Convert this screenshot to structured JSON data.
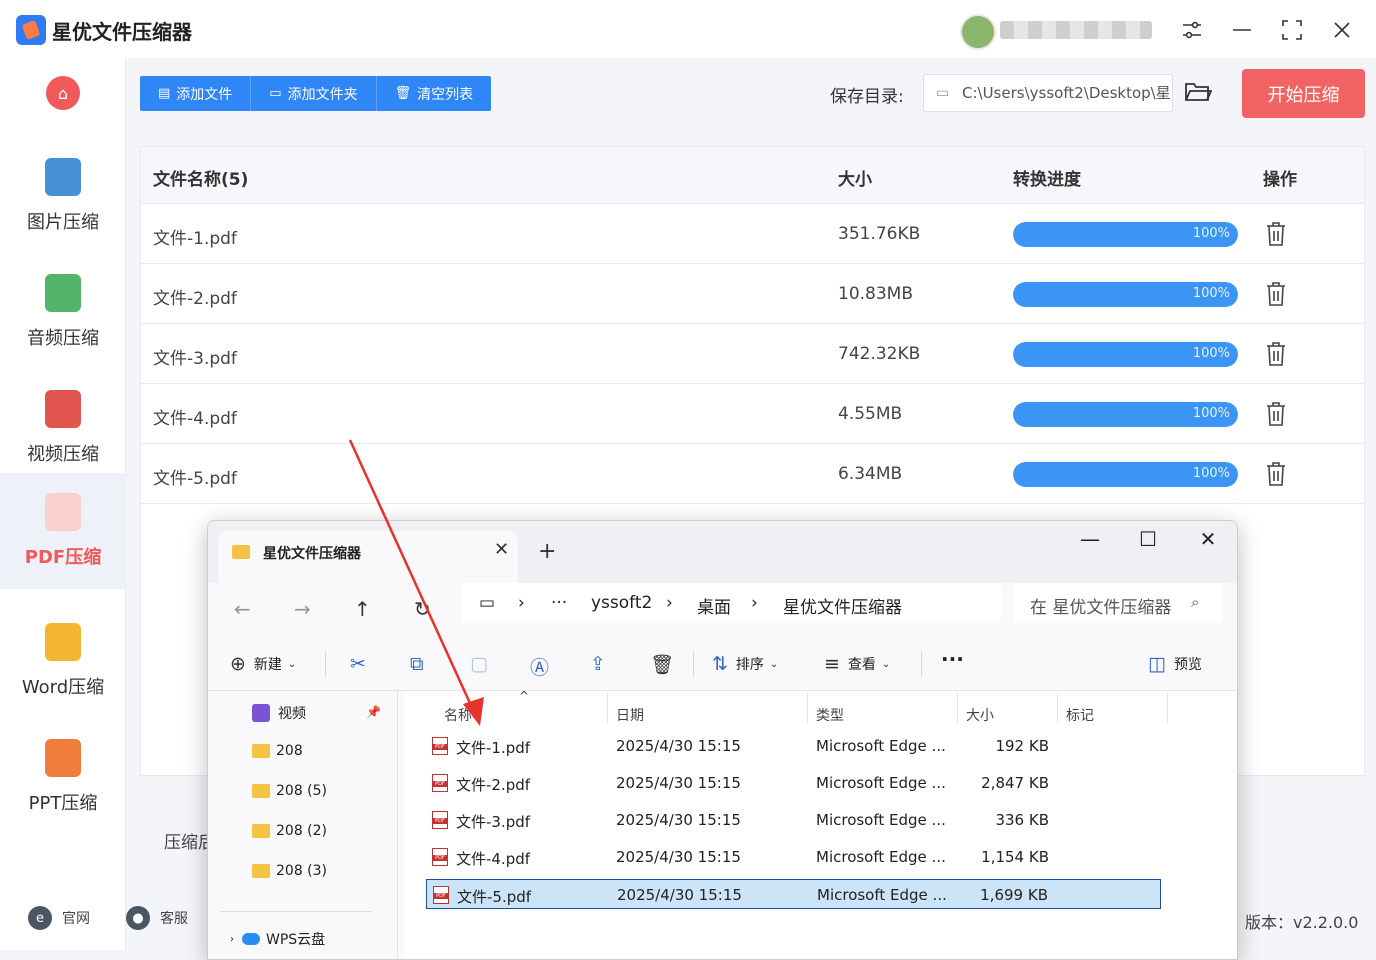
{
  "app": {
    "title": "星优文件压缩器",
    "version": "版本：v2.2.0.0"
  },
  "sidebar": {
    "items": [
      {
        "label": "图片压缩",
        "icon": "image-icon",
        "color": "#4a90d9"
      },
      {
        "label": "音频压缩",
        "icon": "audio-icon",
        "color": "#56b36a"
      },
      {
        "label": "视频压缩",
        "icon": "video-icon",
        "color": "#e0564e"
      },
      {
        "label": "PDF压缩",
        "icon": "pdf-icon",
        "color": "#f15a5a"
      },
      {
        "label": "Word压缩",
        "icon": "word-icon",
        "color": "#f2b632"
      },
      {
        "label": "PPT压缩",
        "icon": "ppt-icon",
        "color": "#ef7d3b"
      }
    ],
    "footer": {
      "website": "官网",
      "support": "客服"
    }
  },
  "toolbar": {
    "add_file": "添加文件",
    "add_folder": "添加文件夹",
    "clear_list": "清空列表",
    "save_label": "保存目录:",
    "save_path": "C:\\Users\\yssoft2\\Desktop\\星",
    "start": "开始压缩"
  },
  "table": {
    "headers": {
      "name": "文件名称(5)",
      "size": "大小",
      "progress": "转换进度",
      "action": "操作"
    },
    "rows": [
      {
        "name": "文件-1.pdf",
        "size": "351.76KB",
        "progress": "100%"
      },
      {
        "name": "文件-2.pdf",
        "size": "10.83MB",
        "progress": "100%"
      },
      {
        "name": "文件-3.pdf",
        "size": "742.32KB",
        "progress": "100%"
      },
      {
        "name": "文件-4.pdf",
        "size": "4.55MB",
        "progress": "100%"
      },
      {
        "name": "文件-5.pdf",
        "size": "6.34MB",
        "progress": "100%"
      }
    ]
  },
  "compress_label": "压缩后",
  "explorer": {
    "tab_title": "星优文件压缩器",
    "breadcrumb": [
      "yssoft2",
      "桌面",
      "星优文件压缩器"
    ],
    "search_placeholder": "在 星优文件压缩器",
    "commands": {
      "new": "新建",
      "sort": "排序",
      "view": "查看",
      "preview": "预览"
    },
    "nav_items": [
      "视频",
      "208",
      "208 (5)",
      "208 (2)",
      "208 (3)",
      "WPS云盘"
    ],
    "columns": {
      "name": "名称",
      "date": "日期",
      "type": "类型",
      "size": "大小",
      "tag": "标记"
    },
    "files": [
      {
        "name": "文件-1.pdf",
        "date": "2025/4/30 15:15",
        "type": "Microsoft Edge ...",
        "size": "192 KB"
      },
      {
        "name": "文件-2.pdf",
        "date": "2025/4/30 15:15",
        "type": "Microsoft Edge ...",
        "size": "2,847 KB"
      },
      {
        "name": "文件-3.pdf",
        "date": "2025/4/30 15:15",
        "type": "Microsoft Edge ...",
        "size": "336 KB"
      },
      {
        "name": "文件-4.pdf",
        "date": "2025/4/30 15:15",
        "type": "Microsoft Edge ...",
        "size": "1,154 KB"
      },
      {
        "name": "文件-5.pdf",
        "date": "2025/4/30 15:15",
        "type": "Microsoft Edge ...",
        "size": "1,699 KB"
      }
    ]
  },
  "colors": {
    "accent_blue": "#2f86f6",
    "accent_red": "#f26464",
    "progress": "#3b95f5"
  }
}
